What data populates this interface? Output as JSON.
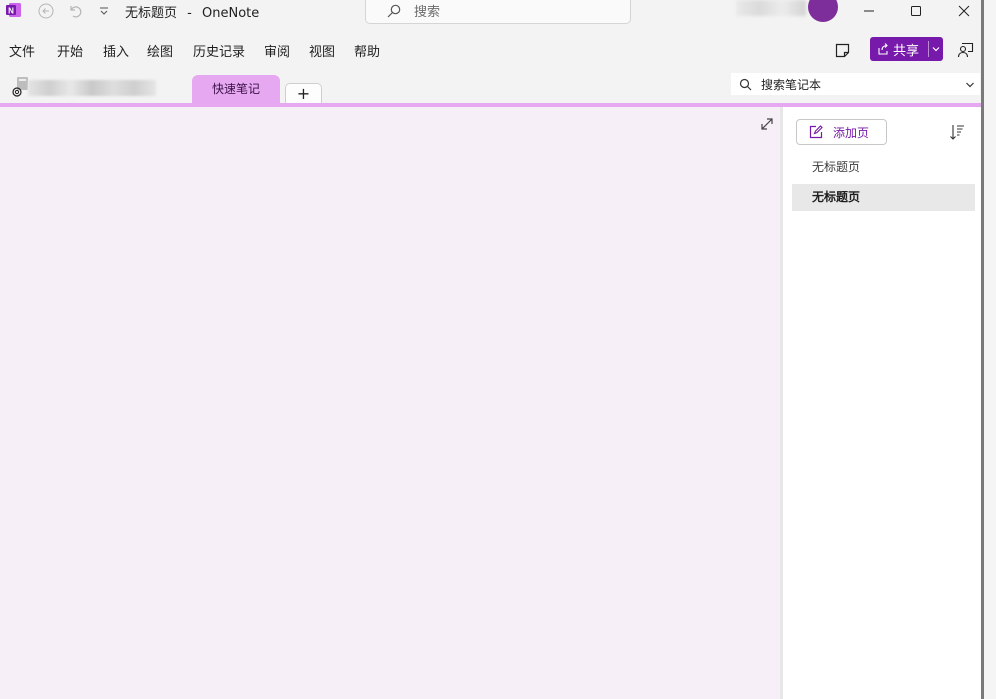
{
  "titlebar": {
    "doc_title": "无标题页",
    "separator": "-",
    "app_name": "OneNote",
    "search_placeholder": "搜索"
  },
  "menu": {
    "items": [
      "文件",
      "开始",
      "插入",
      "绘图",
      "历史记录",
      "审阅",
      "视图",
      "帮助"
    ],
    "share_label": "共享"
  },
  "notebook": {
    "section_tab": "快速笔记",
    "add_section_symbol": "+",
    "search_placeholder": "搜索笔记本"
  },
  "pages": {
    "add_page_label": "添加页",
    "items": [
      "无标题页",
      "无标题页"
    ],
    "selected_index": 1
  },
  "colors": {
    "accent": "#7719aa",
    "section_tab": "#e6a8f0",
    "canvas": "#f7eff7"
  },
  "icons": [
    "onenote-logo-icon",
    "back-icon",
    "undo-icon",
    "customize-qat-icon",
    "search-icon",
    "minimize-icon",
    "maximize-icon",
    "close-icon",
    "sticky-note-icon",
    "share-icon",
    "feedback-icon",
    "notebook-icon",
    "expand-icon",
    "add-page-icon",
    "sort-icon"
  ]
}
